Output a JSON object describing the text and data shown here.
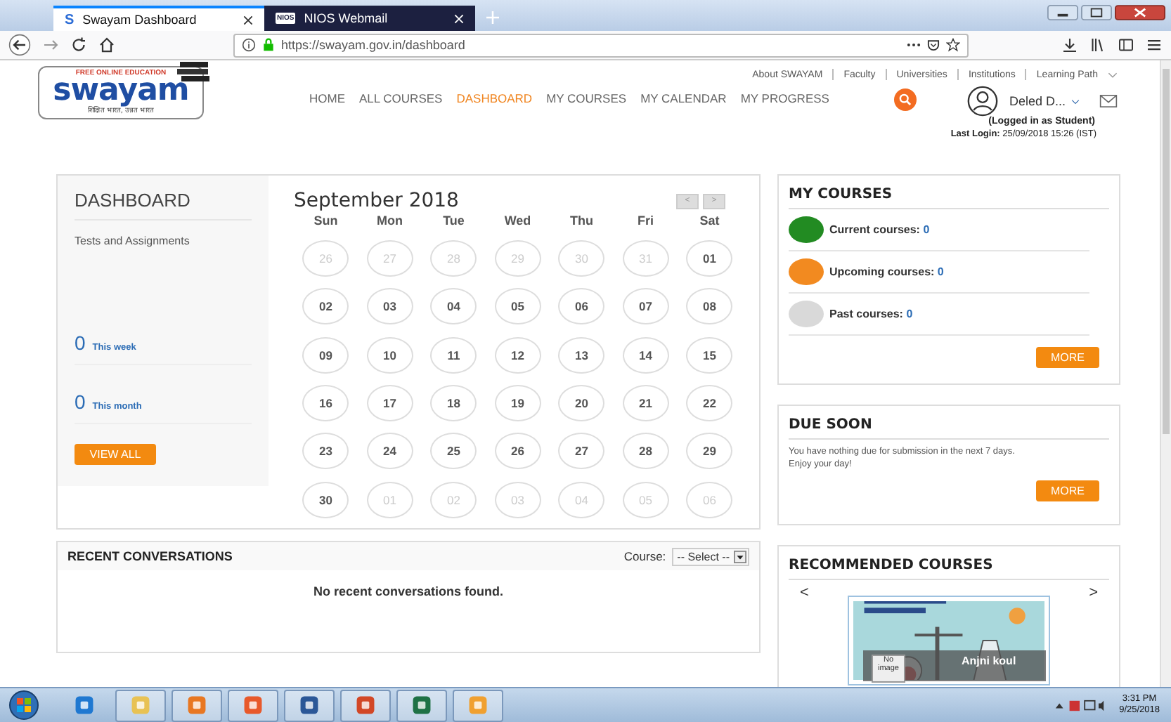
{
  "browser": {
    "tabs": [
      {
        "title": "Swayam Dashboard",
        "selected": true,
        "icon": "S"
      },
      {
        "title": "NIOS Webmail",
        "selected": false,
        "icon": "NIOS"
      }
    ],
    "url": "https://swayam.gov.in/dashboard"
  },
  "logo": {
    "tagline_top": "FREE ONLINE EDUCATION",
    "name": "swayam",
    "tagline_bottom": "शिक्षित भारत, उन्नत भारत"
  },
  "top_links": [
    "About SWAYAM",
    "Faculty",
    "Universities",
    "Institutions",
    "Learning Path"
  ],
  "nav": [
    {
      "label": "HOME",
      "selected": false
    },
    {
      "label": "ALL COURSES",
      "selected": false
    },
    {
      "label": "DASHBOARD",
      "selected": true
    },
    {
      "label": "MY COURSES",
      "selected": false
    },
    {
      "label": "MY CALENDAR",
      "selected": false
    },
    {
      "label": "MY PROGRESS",
      "selected": false
    }
  ],
  "user": {
    "name": "Deled D...",
    "role": "(Logged in as Student)",
    "last_login_label": "Last Login:",
    "last_login": "25/09/2018 15:26 (IST)"
  },
  "dashboard": {
    "title": "DASHBOARD",
    "subtitle": "Tests and Assignments",
    "stats": [
      {
        "count": "0",
        "label": "This week"
      },
      {
        "count": "0",
        "label": "This month"
      }
    ],
    "button": "VIEW ALL"
  },
  "calendar": {
    "title": "September 2018",
    "prev": "<",
    "next": ">",
    "weekdays": [
      "Sun",
      "Mon",
      "Tue",
      "Wed",
      "Thu",
      "Fri",
      "Sat"
    ],
    "days": [
      {
        "day": "26",
        "in_month": false
      },
      {
        "day": "27",
        "in_month": false
      },
      {
        "day": "28",
        "in_month": false
      },
      {
        "day": "29",
        "in_month": false
      },
      {
        "day": "30",
        "in_month": false
      },
      {
        "day": "31",
        "in_month": false
      },
      {
        "day": "01",
        "in_month": true
      },
      {
        "day": "02",
        "in_month": true
      },
      {
        "day": "03",
        "in_month": true
      },
      {
        "day": "04",
        "in_month": true
      },
      {
        "day": "05",
        "in_month": true
      },
      {
        "day": "06",
        "in_month": true
      },
      {
        "day": "07",
        "in_month": true
      },
      {
        "day": "08",
        "in_month": true
      },
      {
        "day": "09",
        "in_month": true
      },
      {
        "day": "10",
        "in_month": true
      },
      {
        "day": "11",
        "in_month": true
      },
      {
        "day": "12",
        "in_month": true
      },
      {
        "day": "13",
        "in_month": true
      },
      {
        "day": "14",
        "in_month": true
      },
      {
        "day": "15",
        "in_month": true
      },
      {
        "day": "16",
        "in_month": true
      },
      {
        "day": "17",
        "in_month": true
      },
      {
        "day": "18",
        "in_month": true
      },
      {
        "day": "19",
        "in_month": true
      },
      {
        "day": "20",
        "in_month": true
      },
      {
        "day": "21",
        "in_month": true
      },
      {
        "day": "22",
        "in_month": true
      },
      {
        "day": "23",
        "in_month": true
      },
      {
        "day": "24",
        "in_month": true
      },
      {
        "day": "25",
        "in_month": true
      },
      {
        "day": "26",
        "in_month": true
      },
      {
        "day": "27",
        "in_month": true
      },
      {
        "day": "28",
        "in_month": true
      },
      {
        "day": "29",
        "in_month": true
      },
      {
        "day": "30",
        "in_month": true
      },
      {
        "day": "01",
        "in_month": false
      },
      {
        "day": "02",
        "in_month": false
      },
      {
        "day": "03",
        "in_month": false
      },
      {
        "day": "04",
        "in_month": false
      },
      {
        "day": "05",
        "in_month": false
      },
      {
        "day": "06",
        "in_month": false
      }
    ]
  },
  "my_courses": {
    "title": "MY COURSES",
    "items": [
      {
        "label": "Current courses:",
        "count": "0",
        "color": "#228b22"
      },
      {
        "label": "Upcoming courses:",
        "count": "0",
        "color": "#f28a20"
      },
      {
        "label": "Past courses:",
        "count": "0",
        "color": "#d9d9d9"
      }
    ],
    "button": "MORE"
  },
  "due_soon": {
    "title": "DUE SOON",
    "message": "You have nothing due for submission in the next 7 days. Enjoy your day!",
    "button": "MORE"
  },
  "recent_conversations": {
    "title": "RECENT CONVERSATIONS",
    "course_label": "Course:",
    "select_value": "-- Select --",
    "empty_message": "No recent conversations found."
  },
  "recommended": {
    "title": "RECOMMENDED COURSES",
    "prev": "<",
    "next": ">",
    "card": {
      "no_image": "No image",
      "instructor": "Anjni koul"
    }
  },
  "taskbar": {
    "time": "3:31 PM",
    "date": "9/25/2018"
  }
}
